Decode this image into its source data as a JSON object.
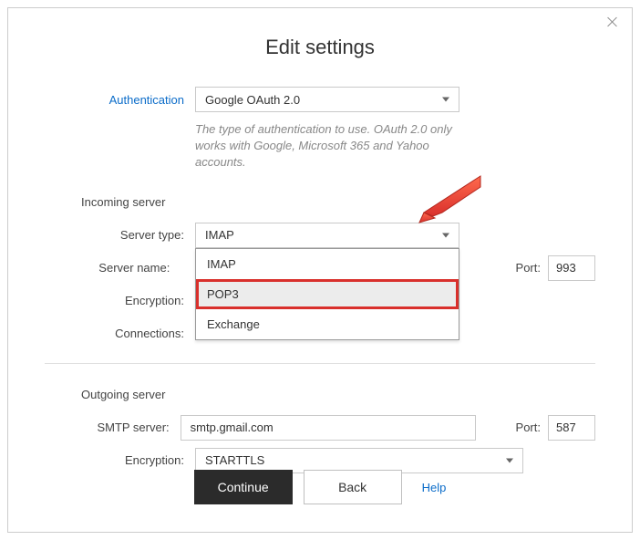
{
  "title": "Edit settings",
  "auth": {
    "label": "Authentication",
    "value": "Google OAuth 2.0",
    "hint": "The type of authentication to use. OAuth 2.0 only works with Google, Microsoft 365 and Yahoo accounts."
  },
  "incoming": {
    "header": "Incoming server",
    "server_type_label": "Server type:",
    "server_type_value": "IMAP",
    "server_type_options": [
      "IMAP",
      "POP3",
      "Exchange"
    ],
    "server_name_label": "Server name:",
    "encryption_label": "Encryption:",
    "connections_label": "Connections:",
    "port_label": "Port:",
    "port_value": "993"
  },
  "outgoing": {
    "header": "Outgoing server",
    "smtp_label": "SMTP server:",
    "smtp_value": "smtp.gmail.com",
    "encryption_label": "Encryption:",
    "encryption_value": "STARTTLS",
    "port_label": "Port:",
    "port_value": "587"
  },
  "footer": {
    "continue": "Continue",
    "back": "Back",
    "help": "Help"
  }
}
